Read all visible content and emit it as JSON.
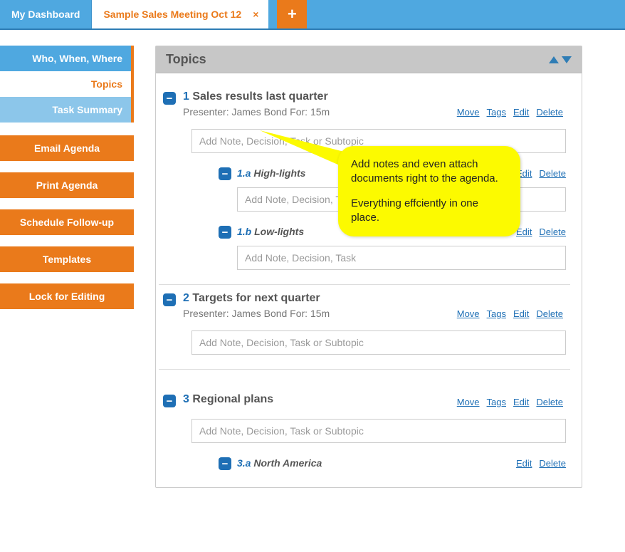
{
  "tabs": {
    "dashboard": "My Dashboard",
    "meeting": "Sample Sales Meeting Oct 12",
    "close": "×",
    "add": "+"
  },
  "sidebar": {
    "nav": {
      "who": "Who, When, Where",
      "topics": "Topics",
      "tasks": "Task Summary"
    },
    "buttons": {
      "email": "Email Agenda",
      "print": "Print Agenda",
      "followup": "Schedule Follow-up",
      "templates": "Templates",
      "lock": "Lock for Editing"
    }
  },
  "panel": {
    "title": "Topics"
  },
  "placeholders": {
    "addNote": "Add Note, Decision, Task or Subtopic",
    "addNoteSub": "Add Note, Decision, Task"
  },
  "actions": {
    "move": "Move",
    "tags": "Tags",
    "edit": "Edit",
    "delete": "Delete"
  },
  "topics": [
    {
      "num": "1",
      "title": "Sales results last quarter",
      "presenter": "Presenter: James Bond For: 15m",
      "subs": [
        {
          "num": "1.a",
          "title": "High-lights"
        },
        {
          "num": "1.b",
          "title": "Low-lights"
        }
      ]
    },
    {
      "num": "2",
      "title": "Targets for next quarter",
      "presenter": "Presenter: James Bond For: 15m",
      "subs": []
    },
    {
      "num": "3",
      "title": "Regional plans",
      "presenter": "",
      "subs": [
        {
          "num": "3.a",
          "title": "North America"
        }
      ]
    }
  ],
  "callout": {
    "line1": "Add notes and even attach documents right to the agenda.",
    "line2": "Everything effciently in one place."
  }
}
